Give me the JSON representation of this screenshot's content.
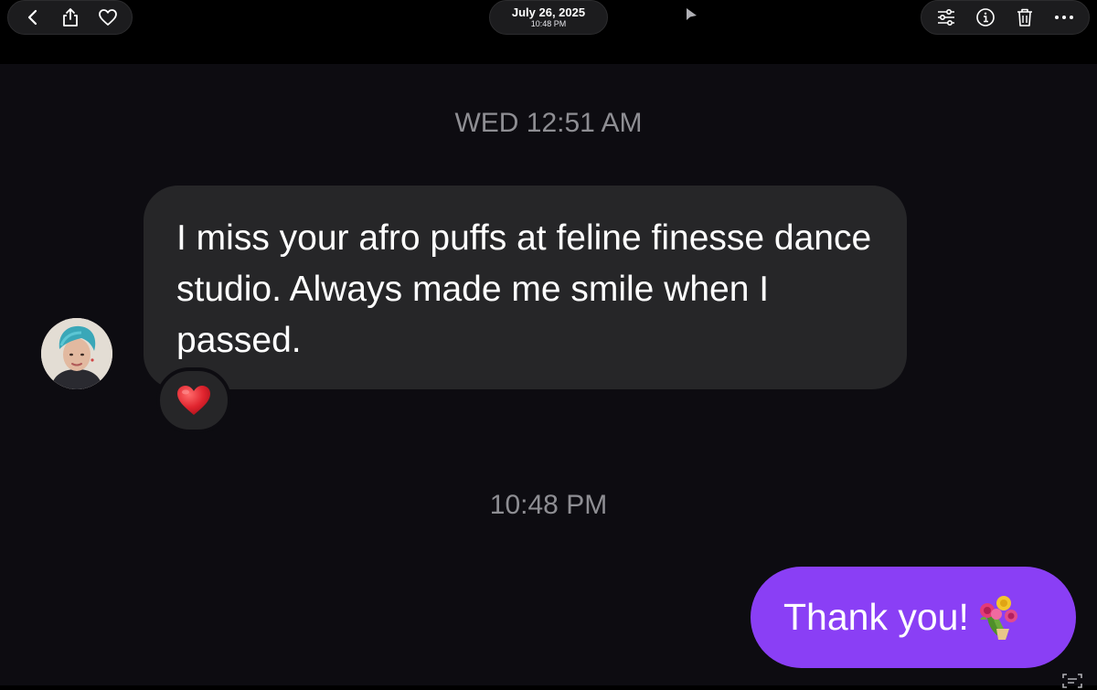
{
  "toolbar": {
    "left_icons": [
      "chevron-left-icon",
      "share-icon",
      "heart-icon"
    ],
    "right_icons": [
      "adjustments-icon",
      "info-icon",
      "trash-icon",
      "more-icon"
    ],
    "date": "July 26, 2025",
    "time": "10:48 PM"
  },
  "conversation": {
    "timestamp_1": "WED 12:51 AM",
    "incoming_message": "I miss your afro puffs at feline finesse dance studio. Always made me smile when I passed.",
    "reaction": "❤️",
    "timestamp_2": "10:48 PM",
    "outgoing_message": "Thank you!",
    "outgoing_emoji": "bouquet-icon"
  },
  "colors": {
    "background": "#0d0c11",
    "incoming_bubble": "#262628",
    "outgoing_bubble": "#8a3ff5",
    "timestamp_text": "#8e8e93",
    "reaction_heart": "#e0242e"
  }
}
